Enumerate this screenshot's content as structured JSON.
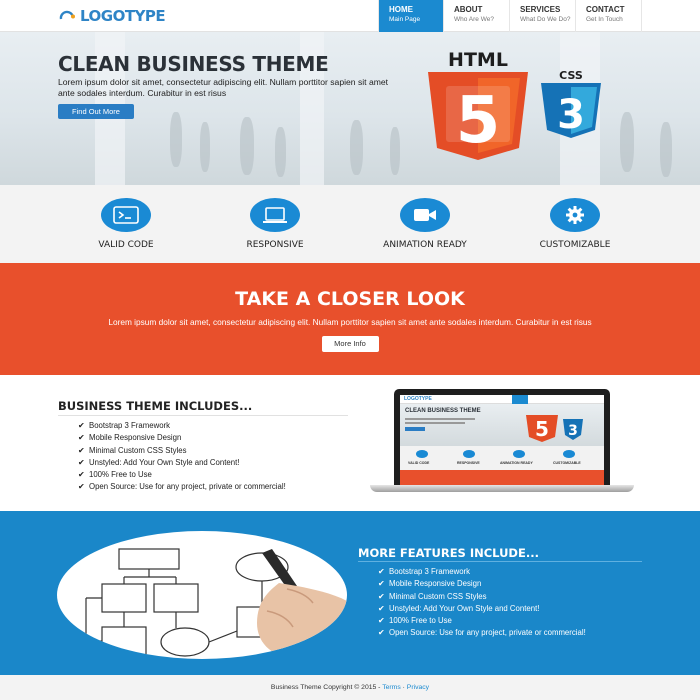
{
  "logo": {
    "text": "LOGOTYPE"
  },
  "nav": [
    {
      "title": "HOME",
      "sub": "Main Page",
      "active": true
    },
    {
      "title": "ABOUT",
      "sub": "Who Are We?"
    },
    {
      "title": "SERVICES",
      "sub": "What Do We Do?"
    },
    {
      "title": "CONTACT",
      "sub": "Get In Touch"
    }
  ],
  "hero": {
    "title": "CLEAN BUSINESS THEME",
    "text": "Lorem ipsum dolor sit amet, consectetur adipiscing elit. Nullam porttitor sapien sit amet ante sodales interdum. Curabitur in est risus",
    "button": "Find Out More",
    "html_badge": "HTML",
    "html_num": "5",
    "css_badge": "CSS",
    "css_num": "3"
  },
  "features": [
    {
      "icon": "terminal-icon",
      "label": "VALID CODE"
    },
    {
      "icon": "laptop-icon",
      "label": "RESPONSIVE"
    },
    {
      "icon": "video-camera-icon",
      "label": "ANIMATION READY"
    },
    {
      "icon": "gear-icon",
      "label": "CUSTOMIZABLE"
    }
  ],
  "closer": {
    "title": "TAKE A CLOSER LOOK",
    "text": "Lorem ipsum dolor sit amet, consectetur adipiscing elit. Nullam porttitor sapien sit amet ante sodales interdum. Curabitur in est risus",
    "button": "More Info"
  },
  "includes": {
    "title": "BUSINESS THEME INCLUDES...",
    "items": [
      "Bootstrap 3 Framework",
      "Mobile Responsive Design",
      "Minimal Custom CSS Styles",
      "Unstyled: Add Your Own Style and Content!",
      "100% Free to Use",
      "Open Source: Use for any project, private or commercial!"
    ]
  },
  "laptop": {
    "logo": "LOGOTYPE",
    "title": "CLEAN BUSINESS THEME",
    "features": [
      "VALID CODE",
      "RESPONSIVE",
      "ANIMATION READY",
      "CUSTOMIZABLE"
    ]
  },
  "more": {
    "title": "MORE FEATURES INCLUDE...",
    "items": [
      "Bootstrap 3 Framework",
      "Mobile Responsive Design",
      "Minimal Custom CSS Styles",
      "Unstyled: Add Your Own Style and Content!",
      "100% Free to Use",
      "Open Source: Use for any project, private or commercial!"
    ]
  },
  "footer": {
    "copyright": "Business Theme Copyright © 2015 - ",
    "terms": "Terms",
    "sep": " · ",
    "privacy": "Privacy"
  },
  "colors": {
    "brand_blue": "#1b8ad0",
    "orange": "#e8502c",
    "html5_orange": "#e44d26",
    "css3_blue": "#1572b6"
  }
}
